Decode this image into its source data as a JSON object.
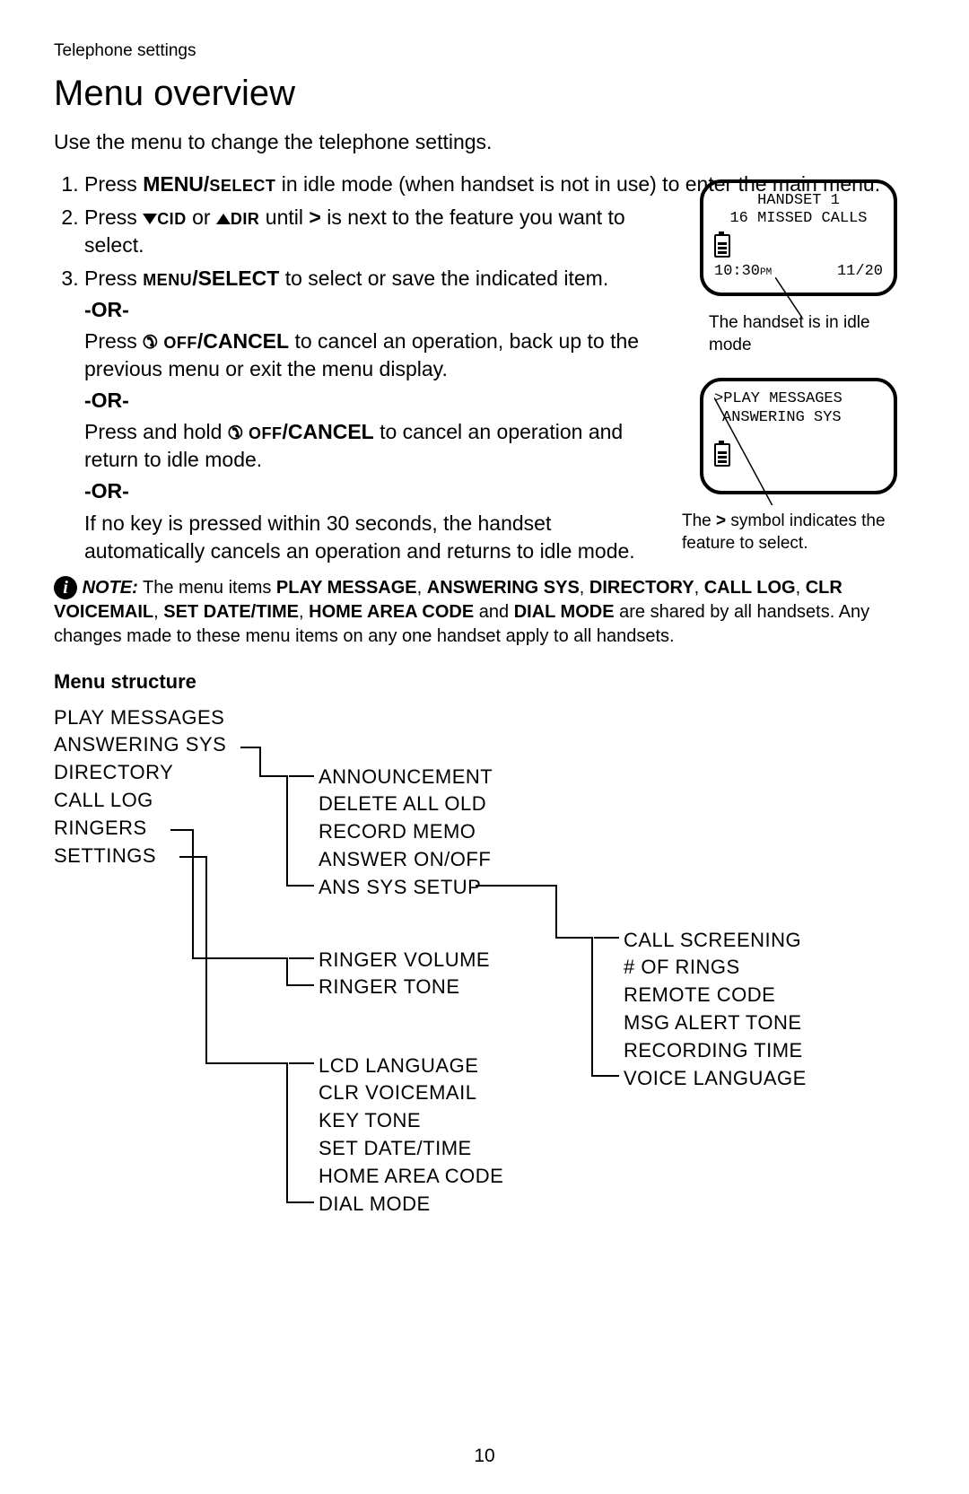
{
  "header": {
    "section_label": "Telephone settings",
    "title": "Menu overview",
    "intro": "Use the menu to change the telephone settings."
  },
  "steps": {
    "s1a": "Press ",
    "s1b": "MENU/",
    "s1c": "SELECT",
    "s1d": " in idle mode (when handset is not in use) to enter the main menu.",
    "s2a": "Press ",
    "s2b": "CID",
    "s2c": " or ",
    "s2d": "DIR",
    "s2e": " until ",
    "s2f": ">",
    "s2g": " is next to the feature you want to select.",
    "s3a": "Press ",
    "s3b": "MENU",
    "s3c": "/SELECT",
    "s3d": " to select or save the indicated item.",
    "or": "-OR-",
    "s4a": "Press ",
    "s4b": "OFF",
    "s4c": "/CANCEL",
    "s4d": " to cancel an operation, back up to the previous menu or exit the menu display.",
    "s5a": "Press and hold ",
    "s5b": "OFF",
    "s5c": "/CANCEL",
    "s5d": " to cancel an operation and return to idle mode.",
    "s6": "If no key is pressed within 30 seconds, the handset automatically cancels an operation and returns to idle mode."
  },
  "note": {
    "label": "NOTE:",
    "t1": " The menu items ",
    "b1": "PLAY MESSAGE",
    "c1": ", ",
    "b2": "ANSWERING SYS",
    "c2": ", ",
    "b3": "DIRECTORY",
    "c3": ", ",
    "b4": "CALL LOG",
    "c4": ", ",
    "b5": "CLR VOICEMAIL",
    "c5": ", ",
    "b6": "SET DATE/TIME",
    "c6": ", ",
    "b7": "HOME AREA CODE",
    "c7": " and ",
    "b8": "DIAL MODE",
    "t2": " are shared by all handsets. Any changes made to these menu items on any one handset apply to all handsets."
  },
  "screen1": {
    "line1": "HANDSET 1",
    "line2": "16 MISSED CALLS",
    "time": "10:30",
    "pm": "PM",
    "date": "11/20",
    "caption": "The handset is in idle mode"
  },
  "screen2": {
    "line1": ">PLAY MESSAGES",
    "line2": "ANSWERING SYS",
    "caption_a": "The ",
    "caption_b": ">",
    "caption_c": " symbol indicates the feature to select."
  },
  "menu_structure": {
    "heading": "Menu structure",
    "col1": [
      "PLAY MESSAGES",
      "ANSWERING SYS",
      "DIRECTORY",
      "CALL LOG",
      "RINGERS",
      "SETTINGS"
    ],
    "col2a": [
      "ANNOUNCEMENT",
      "DELETE ALL OLD",
      "RECORD MEMO",
      "ANSWER ON/OFF",
      "ANS SYS SETUP"
    ],
    "col2b": [
      "RINGER VOLUME",
      "RINGER TONE"
    ],
    "col2c": [
      "LCD LANGUAGE",
      "CLR VOICEMAIL",
      "KEY TONE",
      "SET DATE/TIME",
      "HOME AREA CODE",
      "DIAL MODE"
    ],
    "col3": [
      "CALL SCREENING",
      "# OF RINGS",
      "REMOTE CODE",
      "MSG ALERT TONE",
      "RECORDING TIME",
      "VOICE LANGUAGE"
    ]
  },
  "page_number": "10"
}
